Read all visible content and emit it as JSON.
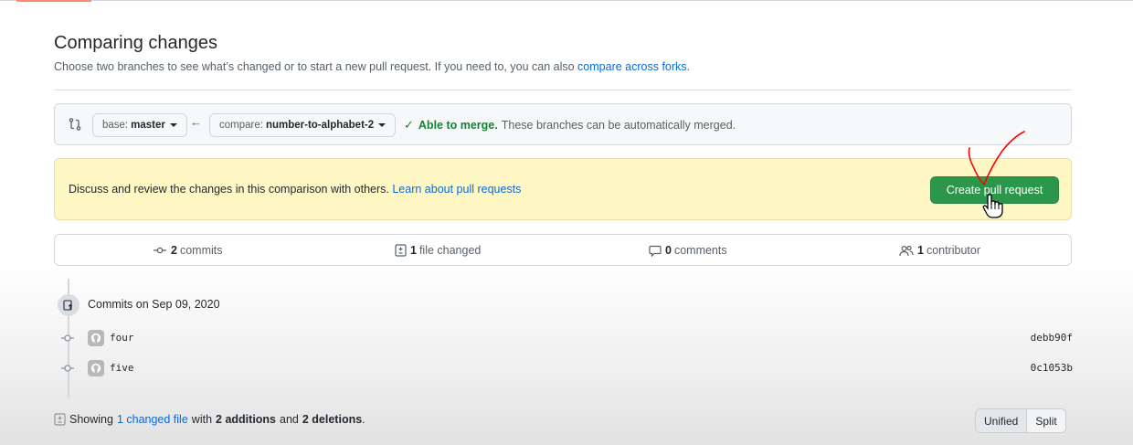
{
  "header": {
    "title": "Comparing changes",
    "subtitle": "Choose two branches to see what’s changed or to start a new pull request. If you need to, you can also",
    "subtitle_link": "compare across forks."
  },
  "range": {
    "base_label": "base:",
    "base_value": "master",
    "compare_label": "compare:",
    "compare_value": "number-to-alphabet-2",
    "merge_ok": "Able to merge.",
    "merge_text": "These branches can be automatically merged."
  },
  "flash": {
    "text": "Discuss and review the changes in this comparison with others.",
    "link": "Learn about pull requests",
    "button": "Create pull request"
  },
  "summary": {
    "commits_count": "2",
    "commits_label": "commits",
    "files_count": "1",
    "files_label": "file changed",
    "comments_count": "0",
    "comments_label": "comments",
    "contributors_count": "1",
    "contributors_label": "contributor"
  },
  "commits": {
    "group_title": "Commits on Sep 09, 2020",
    "items": [
      {
        "message": "four",
        "sha": "debb90f"
      },
      {
        "message": "five",
        "sha": "0c1053b"
      }
    ]
  },
  "diff": {
    "showing": "Showing",
    "changed_link": "1 changed file",
    "with": "with",
    "additions": "2 additions",
    "and": "and",
    "deletions": "2 deletions",
    "period": ".",
    "unified": "Unified",
    "split": "Split"
  },
  "colors": {
    "accent_green": "#2c974b",
    "link_blue": "#0969da",
    "flash_yellow": "#fff8c5",
    "annotation_red": "#ff0000"
  }
}
